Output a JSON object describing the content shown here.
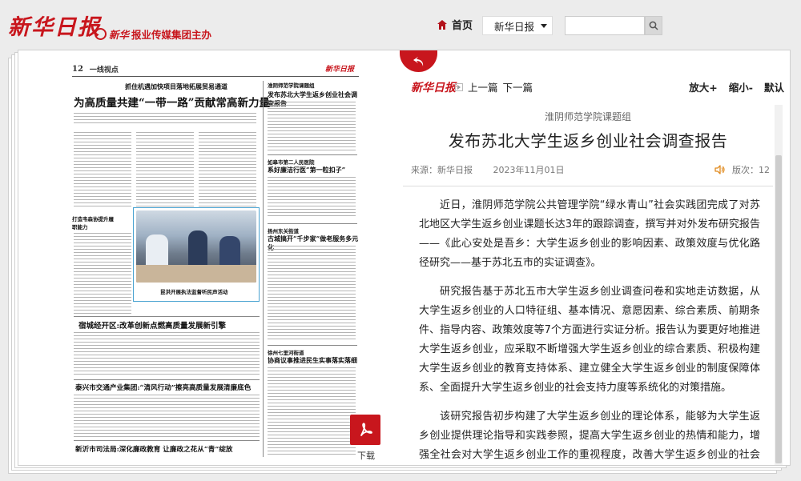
{
  "header": {
    "logo": "新华日报",
    "group_emblem_text": "新华",
    "group_label": "报业传媒集团主办",
    "home_label": "首页",
    "paper_select_value": "新华日报",
    "search": {
      "value": "",
      "placeholder": ""
    }
  },
  "newspaper": {
    "page_number": "12",
    "section": "一线视点",
    "masthead": "新华日报",
    "kicker": "抓住机遇加快项目落地拓展贸易通道",
    "headline": "为高质量共建“一带一路”贡献常高新力量",
    "mini_tag": "打造韦森协提升履职能力",
    "photo_caption": "昆洪开展执法监督听民声活动",
    "right_items": [
      {
        "sub": "淮阴师范学院课题组",
        "title": "发布苏北大学生返乡创业社会调查报告"
      },
      {
        "sub": "如皋市第二人民医院",
        "title": "系好廉洁行医“第一粒扣子”"
      },
      {
        "sub": "扬州东关街道",
        "title": "古城搞开“千步家”做老服务多元化"
      },
      {
        "sub": "徐州七里河街道",
        "title": "协商议事推进民生实事落实落细"
      }
    ],
    "headlines": [
      "宿城经开区:改革创新点燃高质量发展新引擎",
      "泰兴市交通产业集团:“清风行动”擦亮高质量发展清廉底色",
      "新沂市司法局:深化廉政教育 让廉政之花从“青”绽放"
    ]
  },
  "download_label": "下载",
  "article": {
    "logo": "新华日报",
    "prev_label": "上一篇",
    "next_label": "下一篇",
    "zoom_in": "放大+",
    "zoom_out": "缩小-",
    "zoom_default": "默认",
    "kicker": "淮阴师范学院课题组",
    "title": "发布苏北大学生返乡创业社会调查报告",
    "source": "来源：新华日报",
    "date": "2023年11月01日",
    "edition": "版次：12",
    "paragraphs": [
      "近日，淮阴师范学院公共管理学院“绿水青山”社会实践团完成了对苏北地区大学生返乡创业课题长达3年的跟踪调查，撰写并对外发布研究报告——《此心安处是吾乡：大学生返乡创业的影响因素、政策效度与优化路径研究——基于苏北五市的实证调查》。",
      "研究报告基于苏北五市大学生返乡创业调查问卷和实地走访数据，从大学生返乡创业的人口特征组、基本情况、意愿因素、综合素质、前期条件、指导内容、政策效度等7个方面进行实证分析。报告认为要更好地推进大学生返乡创业，应采取不断增强大学生返乡创业的综合素质、积极构建大学生返乡创业的教育支持体系、建立健全大学生返乡创业的制度保障体系、全面提升大学生返乡创业的社会支持力度等系统化的对策措施。",
      "该研究报告初步构建了大学生返乡创业的理论体系，能够为大学生返乡创业提供理论指导和实践参照，提高大学生返乡创业的热情和能力，增强全社会对大学生返乡创业工作的重视程度，改善大学生返乡创业的社会环境。接下来课题组还会持续对此课题开展深入调研，进一步总结大学生返乡创业的经验启示，从而让社会各"
    ]
  },
  "colors": {
    "brand_red": "#c8161d",
    "background": "#ececec"
  }
}
